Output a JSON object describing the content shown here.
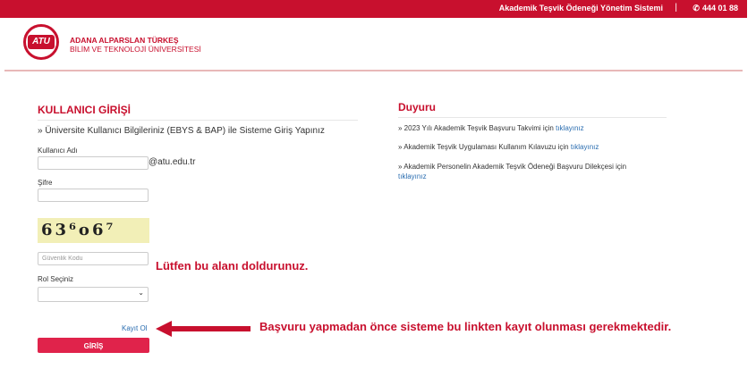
{
  "topbar": {
    "system_name": "Akademik Teşvik Ödeneği Yönetim Sistemi",
    "separator": "|",
    "phone": "444 01 88",
    "phone_icon": "phone-icon",
    "bg_color": "#c8102e"
  },
  "logo": {
    "mark": "ATU",
    "line1": "ADANA ALPARSLAN TÜRKEŞ",
    "line2": "BİLİM VE TEKNOLOJİ ÜNİVERSİTESİ"
  },
  "login": {
    "title": "KULLANICI GİRİŞİ",
    "subtitle": "» Üniversite Kullanıcı Bilgileriniz (EBYS & BAP) ile Sisteme Giriş Yapınız",
    "username_label": "Kullanıcı Adı",
    "username_value": "",
    "domain_suffix": "@atu.edu.tr",
    "password_label": "Şifre",
    "password_value": "",
    "captcha_text": "63⁶o6⁷",
    "security_placeholder": "Güvenlik Kodu",
    "role_label": "Rol Seçiniz",
    "role_selected": "",
    "register_link": "Kayıt Ol",
    "submit_label": "GİRİŞ"
  },
  "annotations": {
    "warning": "Lütfen bu alanı doldurunuz.",
    "register_note": "Başvuru yapmadan önce sisteme bu linkten kayıt olunması gerekmektedir.",
    "accent_color": "#c8102e"
  },
  "announcements": {
    "title": "Duyuru",
    "items": [
      {
        "text": "» 2023 Yılı Akademik Teşvik Başvuru Takvimi için ",
        "link": "tıklayınız"
      },
      {
        "text": "» Akademik Teşvik Uygulaması Kullanım Kılavuzu için ",
        "link": "tıklayınız"
      },
      {
        "text": "» Akademik Personelin Akademik Teşvik Ödeneği Başvuru Dilekçesi için ",
        "link": "tıklayınız"
      }
    ]
  }
}
